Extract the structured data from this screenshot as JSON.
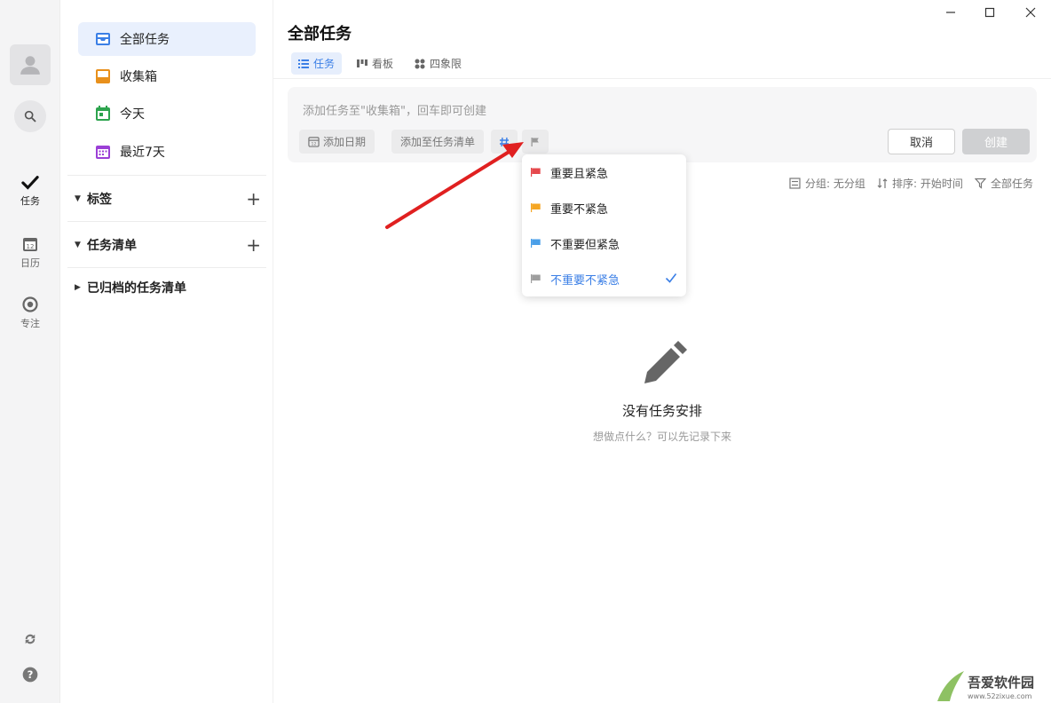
{
  "window": {
    "minimize": "—",
    "maximize": "☐",
    "close": "✕"
  },
  "rail": {
    "items": [
      {
        "label": "任务",
        "icon": "check-icon"
      },
      {
        "label": "日历",
        "icon": "calendar-icon",
        "day": "12"
      },
      {
        "label": "专注",
        "icon": "focus-icon"
      }
    ]
  },
  "sidebar": {
    "nav": [
      {
        "label": "全部任务",
        "icon": "inbox-all-icon",
        "color": "#3b7fe6"
      },
      {
        "label": "收集箱",
        "icon": "inbox-icon",
        "color": "#e8901c"
      },
      {
        "label": "今天",
        "icon": "today-icon",
        "color": "#2da44e"
      },
      {
        "label": "最近7天",
        "icon": "week-icon",
        "color": "#9b3fd6"
      }
    ],
    "sections": [
      {
        "label": "标签"
      },
      {
        "label": "任务清单"
      },
      {
        "label": "已归档的任务清单"
      }
    ]
  },
  "main": {
    "title": "全部任务",
    "tabs": [
      {
        "label": "任务",
        "icon": "list-icon"
      },
      {
        "label": "看板",
        "icon": "kanban-icon"
      },
      {
        "label": "四象限",
        "icon": "quadrant-icon"
      }
    ],
    "composer": {
      "placeholder": "添加任务至\"收集箱\"，回车即可创建",
      "add_date": "添加日期",
      "add_to_list": "添加至任务清单",
      "cancel": "取消",
      "create": "创建"
    },
    "toolbar": {
      "group": "分组: 无分组",
      "sort": "排序: 开始时间",
      "filter": "全部任务"
    },
    "empty": {
      "title": "没有任务安排",
      "subtitle": "想做点什么？可以先记录下来"
    }
  },
  "priority_menu": {
    "items": [
      {
        "label": "重要且紧急",
        "color": "#e5484d"
      },
      {
        "label": "重要不紧急",
        "color": "#f5a623"
      },
      {
        "label": "不重要但紧急",
        "color": "#4a9fe8"
      },
      {
        "label": "不重要不紧急",
        "color": "#9e9e9e",
        "selected": true
      }
    ]
  },
  "colors": {
    "accent": "#3b7fe6",
    "arrow": "#e02020"
  },
  "watermark": {
    "text": "吾爱软件园",
    "url": "www.52zixue.com"
  }
}
